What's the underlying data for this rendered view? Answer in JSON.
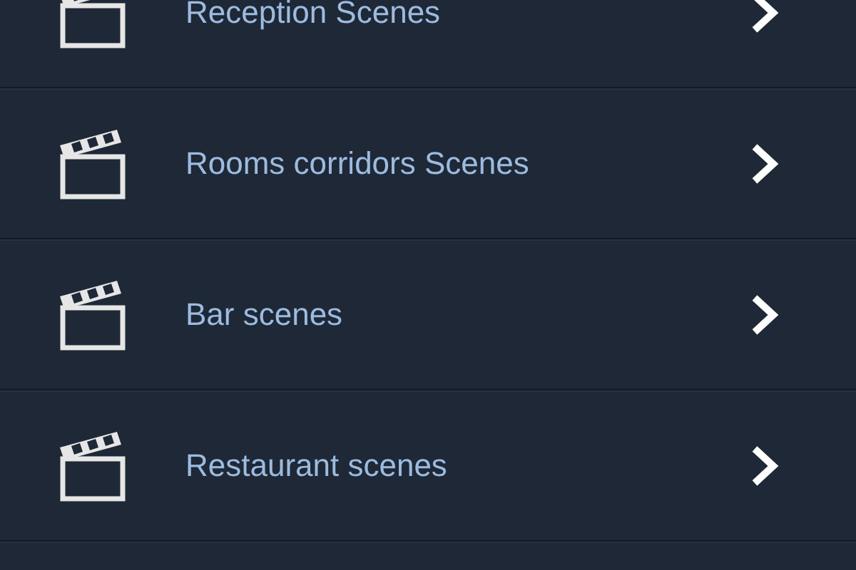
{
  "scenes": [
    {
      "label": "Reception Scenes"
    },
    {
      "label": "Rooms corridors Scenes"
    },
    {
      "label": "Bar scenes"
    },
    {
      "label": "Restaurant scenes"
    }
  ]
}
